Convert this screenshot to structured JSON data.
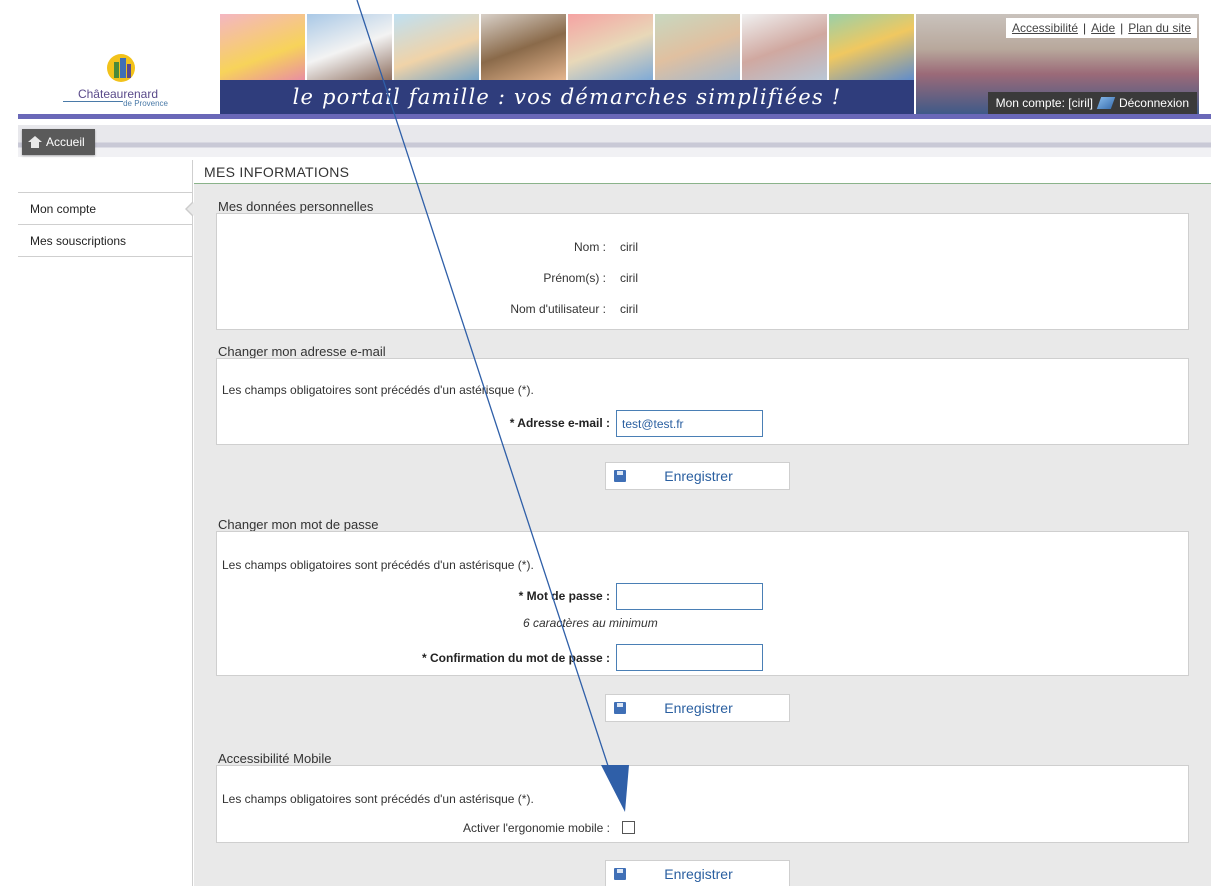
{
  "header": {
    "logo_text": "Châteaurenard",
    "logo_sub": "de Provence",
    "tagline": "le portail famille : vos démarches simplifiées !",
    "top_links": [
      "Accessibilité",
      "Aide",
      "Plan du site"
    ],
    "top_links_separator": "|",
    "account_label": "Mon compte: [ciril]",
    "logout_label": "Déconnexion",
    "colors": {
      "brand": "#2f3d7c",
      "accent": "#6a68b8"
    }
  },
  "nav": {
    "home_label": "Accueil"
  },
  "sidebar": {
    "items": [
      {
        "label": "Mon compte",
        "active": true
      },
      {
        "label": "Mes souscriptions",
        "active": false
      }
    ]
  },
  "main": {
    "section_title": "MES INFORMATIONS",
    "personal": {
      "legend": "Mes données personnelles",
      "rows": [
        {
          "label": "Nom :",
          "value": "ciril"
        },
        {
          "label": "Prénom(s) :",
          "value": "ciril"
        },
        {
          "label": "Nom d'utilisateur :",
          "value": "ciril"
        }
      ]
    },
    "email": {
      "legend": "Changer mon adresse e-mail",
      "hint": "Les champs obligatoires sont précédés d'un astérisque (*).",
      "field_label": "* Adresse e-mail :",
      "field_value": "test@test.fr",
      "save_label": "Enregistrer"
    },
    "password": {
      "legend": "Changer mon mot de passe",
      "hint": "Les champs obligatoires sont précédés d'un astérisque (*).",
      "password_label": "* Mot de passe :",
      "password_value": "",
      "min_note": "6 caractères au minimum",
      "confirm_label": "* Confirmation du mot de passe :",
      "confirm_value": "",
      "save_label": "Enregistrer"
    },
    "mobile": {
      "legend": "Accessibilité Mobile",
      "hint": "Les champs obligatoires sont précédés d'un astérisque (*).",
      "checkbox_label": "Activer l'ergonomie mobile :",
      "checkbox_checked": false,
      "save_label": "Enregistrer"
    }
  },
  "annotation": {
    "arrow_color": "#2f5fa8"
  }
}
